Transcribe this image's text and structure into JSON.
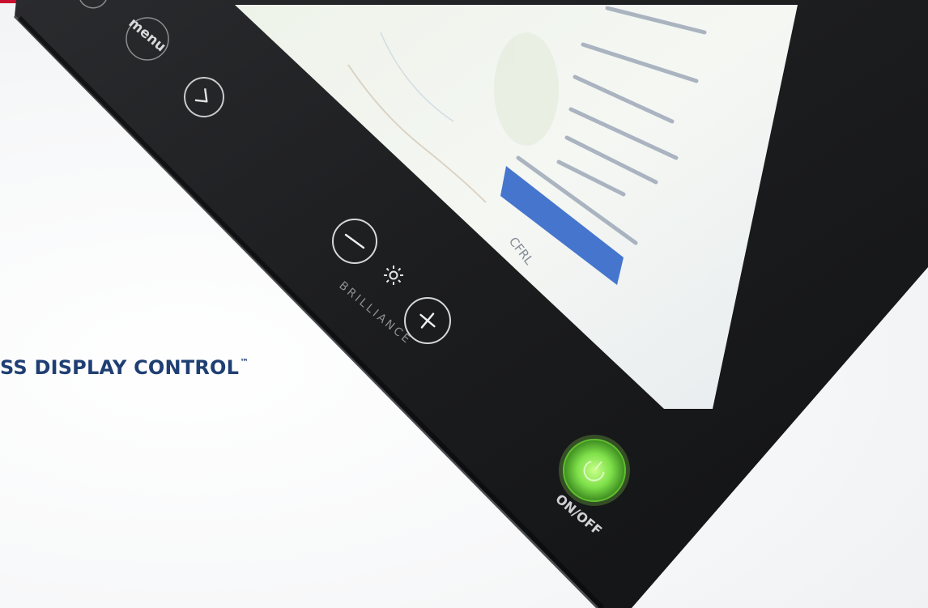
{
  "tagline": {
    "text": "SS DISPLAY CONTROL",
    "trademark": "™"
  },
  "bezel": {
    "menu_label": "menu",
    "brilliance_label": "BRILLIANCE",
    "onoff_label": "ON/OFF",
    "buttons": {
      "next": "chevron-right-icon",
      "minus": "minus-icon",
      "plus": "plus-icon",
      "brightness": "sun-icon",
      "power": "power-icon"
    }
  },
  "screen": {
    "label": "CFRL"
  },
  "colors": {
    "accent_red": "#c8102e",
    "brand_blue": "#1f3f73",
    "bezel": "#1b1c1e",
    "power_green": "#7ee04a",
    "highlight_blue": "#2d63c8"
  }
}
